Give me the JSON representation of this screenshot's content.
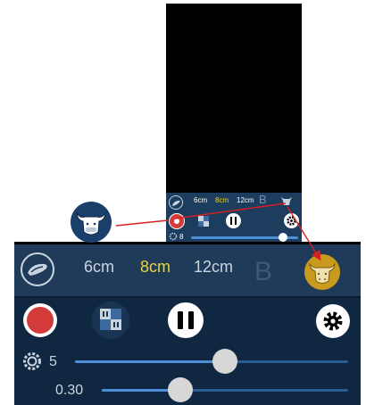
{
  "mini_panel": {
    "distances": [
      "6cm",
      "8cm",
      "12cm"
    ],
    "selected_distance": "8cm",
    "mode_label": "B",
    "slider_value": "8",
    "slider_level": 0.95
  },
  "panel": {
    "distances": [
      "6cm",
      "8cm",
      "12cm"
    ],
    "selected_distance": "8cm",
    "mode_label": "B",
    "cycle_value": "5",
    "cycle_level": 0.55,
    "second_value": "0.30",
    "second_level": 0.32
  },
  "colors": {
    "selected_text": "#e8d43a",
    "record_red": "#d33a3a",
    "arrow_red": "#d92020",
    "cow_badge_gold": "#c89a1e",
    "callout_badge_blue": "#1b3f6b"
  },
  "icons": {
    "probe": "pancreas-probe-icon",
    "grid": "grid-pattern-icon",
    "pause": "pause-icon",
    "settings": "gear-icon",
    "record": "record-icon",
    "cow": "cow-head-icon",
    "cycle": "cycle-settings-icon"
  }
}
